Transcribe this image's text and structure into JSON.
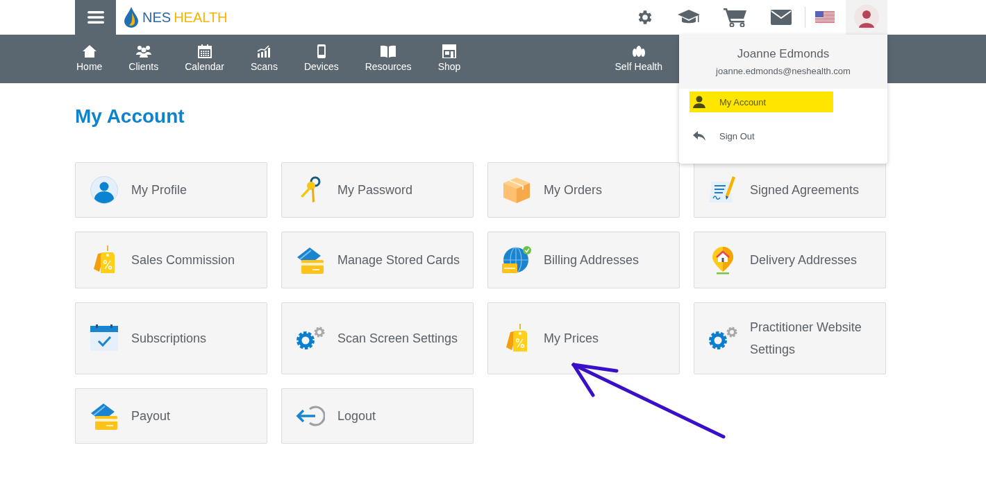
{
  "header": {
    "logo": {
      "first": "NES",
      "second": "HEALTH"
    }
  },
  "nav": {
    "items": [
      {
        "label": "Home"
      },
      {
        "label": "Clients"
      },
      {
        "label": "Calendar"
      },
      {
        "label": "Scans"
      },
      {
        "label": "Devices"
      },
      {
        "label": "Resources"
      },
      {
        "label": "Shop"
      },
      {
        "label": "Self Health"
      }
    ]
  },
  "user_menu": {
    "name": "Joanne Edmonds",
    "email": "joanne.edmonds@neshealth.com",
    "items": [
      {
        "label": "My Account",
        "selected": true
      },
      {
        "label": "Sign Out",
        "selected": false
      }
    ]
  },
  "page": {
    "title": "My Account"
  },
  "tiles": [
    {
      "label": "My Profile"
    },
    {
      "label": "My Password"
    },
    {
      "label": "My Orders"
    },
    {
      "label": "Signed Agreements"
    },
    {
      "label": "Sales Commission"
    },
    {
      "label": "Manage Stored Cards"
    },
    {
      "label": "Billing Addresses"
    },
    {
      "label": "Delivery Addresses"
    },
    {
      "label": "Subscriptions"
    },
    {
      "label": "Scan Screen Settings"
    },
    {
      "label": "My Prices"
    },
    {
      "label": "Practitioner Website Settings"
    },
    {
      "label": "Payout"
    },
    {
      "label": "Logout"
    }
  ]
}
